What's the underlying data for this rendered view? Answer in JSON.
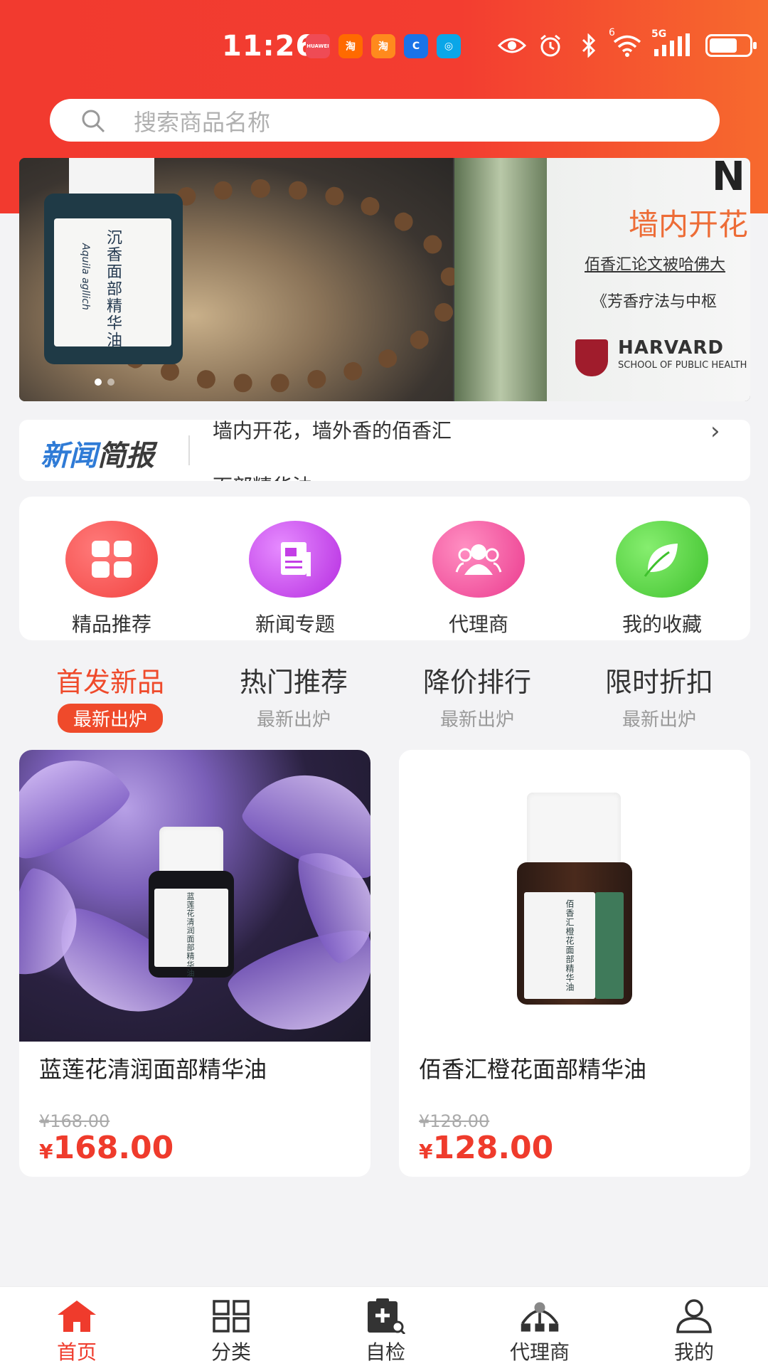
{
  "status_bar": {
    "time": "11:26",
    "app_icons": [
      {
        "icon": "huawei-app-icon",
        "text": "HUAWEI",
        "color": "#ef4b55"
      },
      {
        "icon": "taobao-icon",
        "text": "淘",
        "color": "#ff6a00"
      },
      {
        "icon": "taobao-flash-icon",
        "text": "淘",
        "color": "#ff8a1d"
      },
      {
        "icon": "browser-icon",
        "text": "C",
        "color": "#1a73e8"
      },
      {
        "icon": "china-mobile-icon",
        "text": "◎",
        "color": "#0aa6e8"
      }
    ],
    "network": "5G",
    "wifi_badge": "6"
  },
  "search": {
    "placeholder": "搜索商品名称"
  },
  "banner": {
    "slide1": {
      "bottle_name": "沉香面部精华油",
      "bottle_latin": "Aquila agllich"
    },
    "slide2": {
      "corner_text": "N",
      "title": "墙内开花",
      "line1": "佰香汇论文被哈佛大",
      "line2": "《芳香疗法与中枢",
      "institution": "HARVARD",
      "institution_sub": "SCHOOL OF PUBLIC HEALTH"
    }
  },
  "news": {
    "badge_part1": "新闻",
    "badge_part2": "简报",
    "items": [
      {
        "text": "墙内开花，墙外香的佰香汇"
      },
      {
        "text": "面部精华油"
      }
    ]
  },
  "quick_nav": [
    {
      "label": "精品推荐",
      "icon": "grid-icon",
      "color": "#f44b4b"
    },
    {
      "label": "新闻专题",
      "icon": "document-icon",
      "color": "#c33ee6"
    },
    {
      "label": "代理商",
      "icon": "users-icon",
      "color": "#f0479a"
    },
    {
      "label": "我的收藏",
      "icon": "leaf-icon",
      "color": "#4ccf3b"
    }
  ],
  "tabs": [
    {
      "title": "首发新品",
      "sub": "最新出炉",
      "active": true
    },
    {
      "title": "热门推荐",
      "sub": "最新出炉",
      "active": false
    },
    {
      "title": "降价排行",
      "sub": "最新出炉",
      "active": false
    },
    {
      "title": "限时折扣",
      "sub": "最新出炉",
      "active": false
    }
  ],
  "products": [
    {
      "name": "蓝莲花清润面部精华油",
      "old_price": "¥168.00",
      "currency": "¥",
      "price": "168.00",
      "bottle_text": "蓝莲花清润面部精华油"
    },
    {
      "name": "佰香汇橙花面部精华油",
      "old_price": "¥128.00",
      "currency": "¥",
      "price": "128.00",
      "bottle_text": "佰香汇橙花面部精华油"
    }
  ],
  "bottom_nav": [
    {
      "label": "首页",
      "icon": "home-icon",
      "active": true
    },
    {
      "label": "分类",
      "icon": "category-grid-icon",
      "active": false
    },
    {
      "label": "自检",
      "icon": "clipboard-check-icon",
      "active": false
    },
    {
      "label": "代理商",
      "icon": "network-icon",
      "active": false
    },
    {
      "label": "我的",
      "icon": "user-icon",
      "active": false
    }
  ],
  "colors": {
    "brand_red": "#f23a2f",
    "accent_orange": "#f76a2e",
    "price_red": "#ef3b2c"
  }
}
